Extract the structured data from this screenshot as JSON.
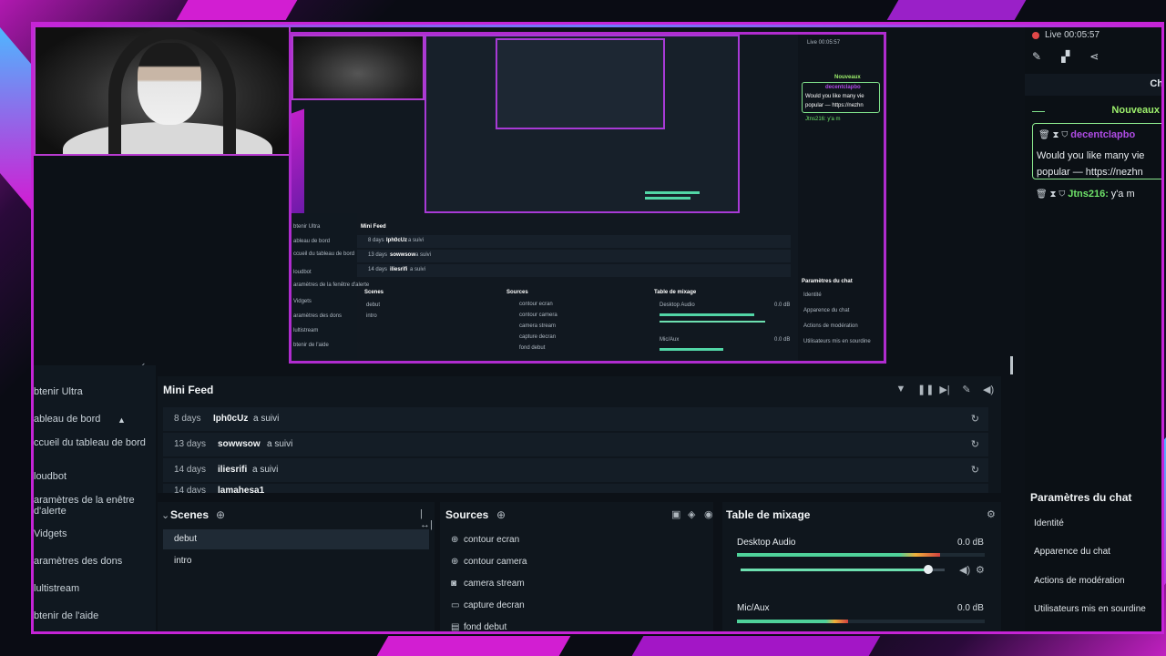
{
  "chat": {
    "live_label": "Live 00:05:57",
    "header_title": "Ch",
    "nouveaux_label": "Nouveaux",
    "message1": {
      "user": "decentclapbo",
      "line1": "Would you like many vie",
      "line2": "popular — https://nezhn"
    },
    "message2": {
      "user": "Jtns216:",
      "text": "y'a m"
    },
    "settings_title": "Paramètres du chat",
    "settings": [
      "Identité",
      "Apparence du chat",
      "Actions de modération",
      "Utilisateurs mis en sourdine"
    ]
  },
  "leftnav": {
    "items": [
      "btenir Ultra",
      "ableau de bord",
      "ccueil du tableau de bord",
      "loudbot",
      "aramètres de la enêtre d'alerte",
      "Vidgets",
      "aramètres des dons",
      "lultistream",
      "btenir de l'aide"
    ]
  },
  "minifeed": {
    "title": "Mini Feed",
    "rows": [
      {
        "days": "8 days",
        "user": "Iph0cUz",
        "action": "a suivi"
      },
      {
        "days": "13 days",
        "user": "sowwsow",
        "action": "a suivi"
      },
      {
        "days": "14 days",
        "user": "iliesrifi",
        "action": "a suivi"
      },
      {
        "days": "14 days",
        "user": "lamahesa1",
        "action": "a suivi"
      }
    ]
  },
  "scenes": {
    "title": "Scenes",
    "items": [
      "debut",
      "intro"
    ]
  },
  "sources": {
    "title": "Sources",
    "items": [
      "contour ecran",
      "contour camera",
      "camera stream",
      "capture decran",
      "fond debut"
    ]
  },
  "mixer": {
    "title": "Table de mixage",
    "channels": [
      {
        "name": "Desktop Audio",
        "db": "0.0 dB",
        "level": 0.82,
        "volume": 0.92
      },
      {
        "name": "Mic/Aux",
        "db": "0.0 dB",
        "level": 0.45,
        "volume": 0.72
      }
    ]
  },
  "preview": {
    "mini_feed": "Mini Feed",
    "rows": [
      {
        "days": "8 days",
        "user": "Iph0cUz",
        "action": "a suivi"
      },
      {
        "days": "13 days",
        "user": "sowwsow",
        "action": "a suivi"
      },
      {
        "days": "14 days",
        "user": "iliesrifi",
        "action": "a suivi"
      }
    ],
    "scenes": "Scenes",
    "sources": "Sources",
    "mixer": "Table de mixage",
    "scene_items": [
      "debut",
      "intro"
    ],
    "source_items": [
      "contour ecran",
      "contour camera",
      "camera stream",
      "capture decran",
      "fond debut"
    ],
    "mixer_items": [
      "Desktop Audio",
      "Mic/Aux"
    ],
    "db": "0.0 dB",
    "chat_settings": "Paramètres du chat",
    "chat_setting_items": [
      "Identité",
      "Apparence du chat",
      "Actions de modération",
      "Utilisateurs mis en sourdine"
    ],
    "nav_items": [
      "btenir Ultra",
      "ableau de bord",
      "ccueil du tableau de bord",
      "loudbot",
      "aramètres de la fenêtre d'alerte",
      "Vidgets",
      "aramètres des dons",
      "lultistream",
      "btenir de l'aide"
    ],
    "live_label": "Live 00:05:57",
    "nouveaux_label": "Nouveaux",
    "chat_user": "decentclapbo",
    "chat_line1": "Would you like many vie",
    "chat_line2": "popular — https://nezhn",
    "chat_user2": "Jtns216: y'a m"
  }
}
